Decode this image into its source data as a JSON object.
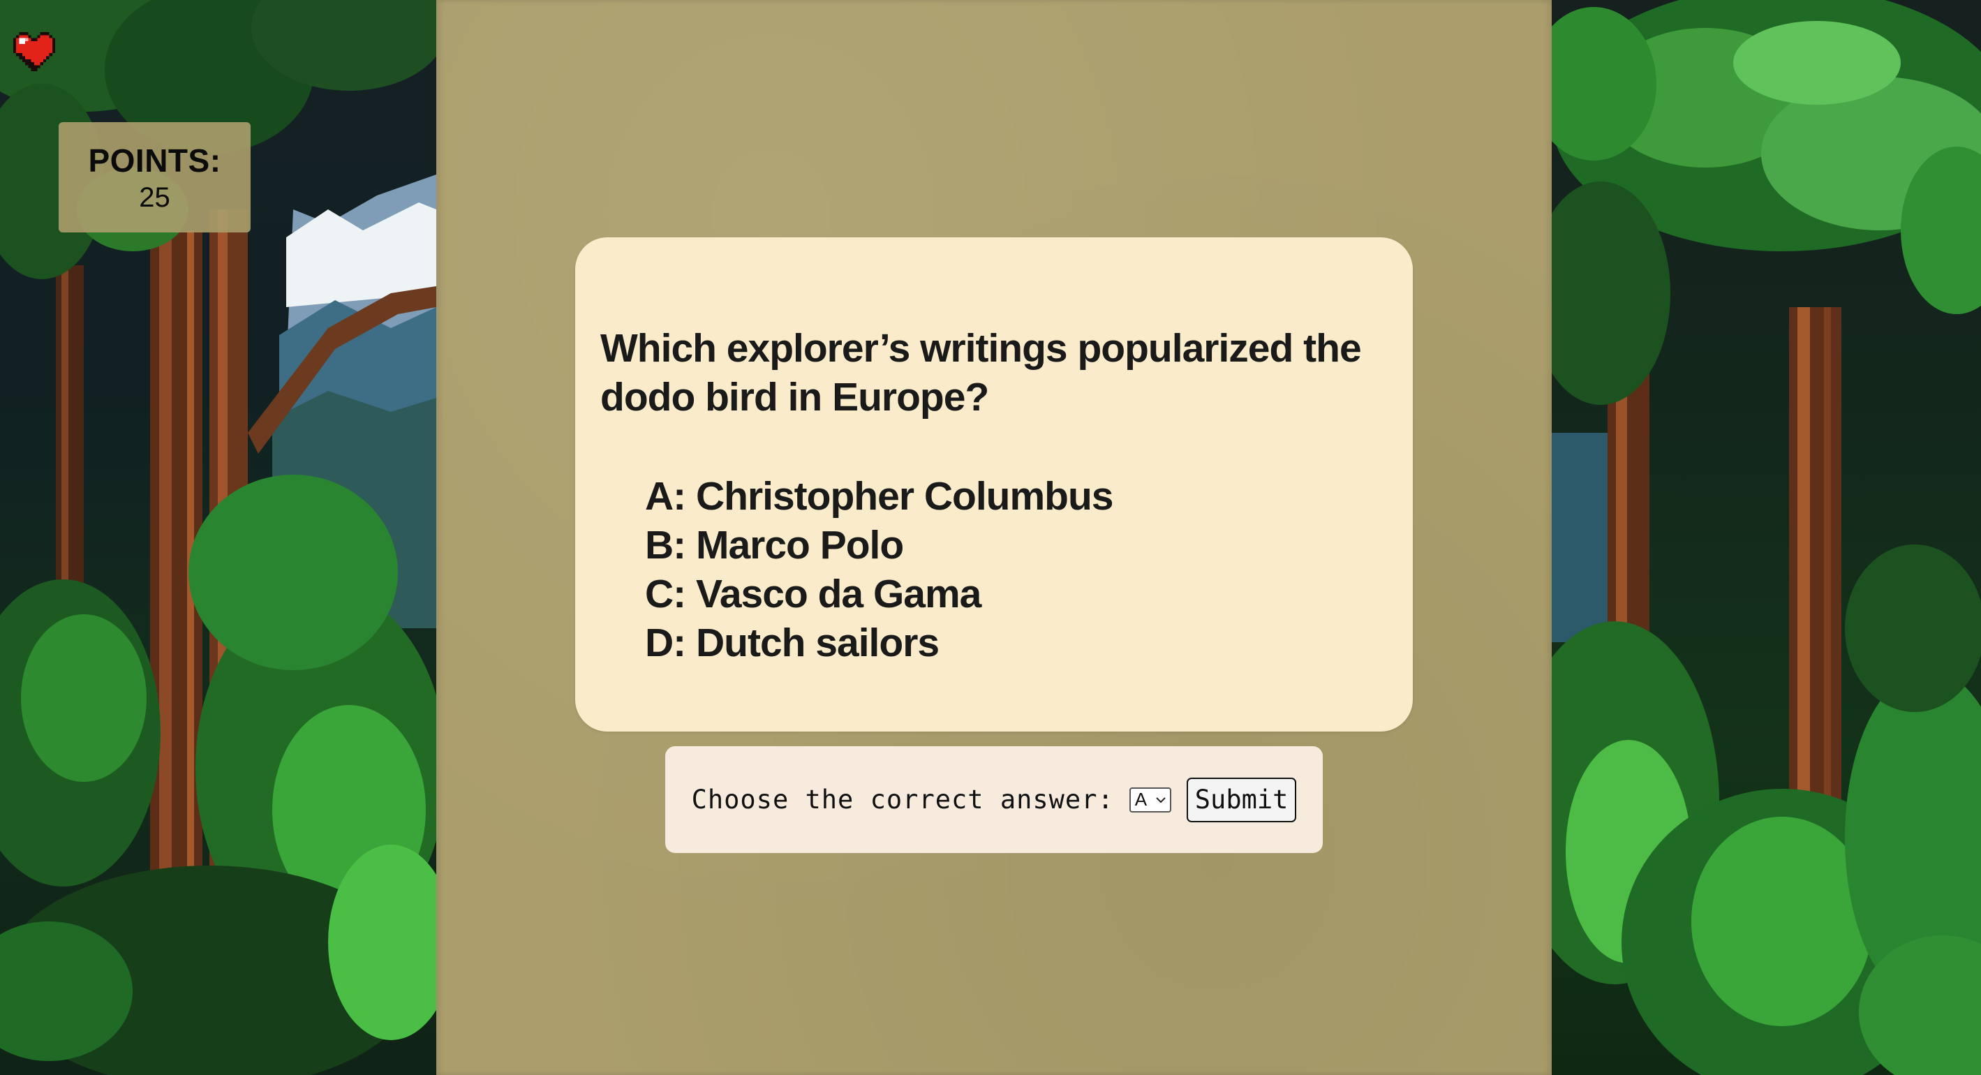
{
  "hud": {
    "lives": 1,
    "life_icon": "heart-icon",
    "points_label": "POINTS:",
    "points_value": "25"
  },
  "question": {
    "text": "Which explorer’s writings popularized the dodo bird in Europe?",
    "options": [
      "A: Christopher Columbus",
      "B: Marco Polo",
      "C: Vasco da Gama",
      "D: Dutch sailors"
    ]
  },
  "answer": {
    "prompt": "Choose the correct answer:",
    "selected": "A",
    "submit_label": "Submit"
  },
  "colors": {
    "parchment": "#ab9e6c",
    "card": "#faebca",
    "answer_bar": "#f6ebdc",
    "heart": "#e2231a",
    "jungle_dark": "#111a1c",
    "foliage": "#2f8a2c",
    "trunk": "#8a4a24"
  }
}
